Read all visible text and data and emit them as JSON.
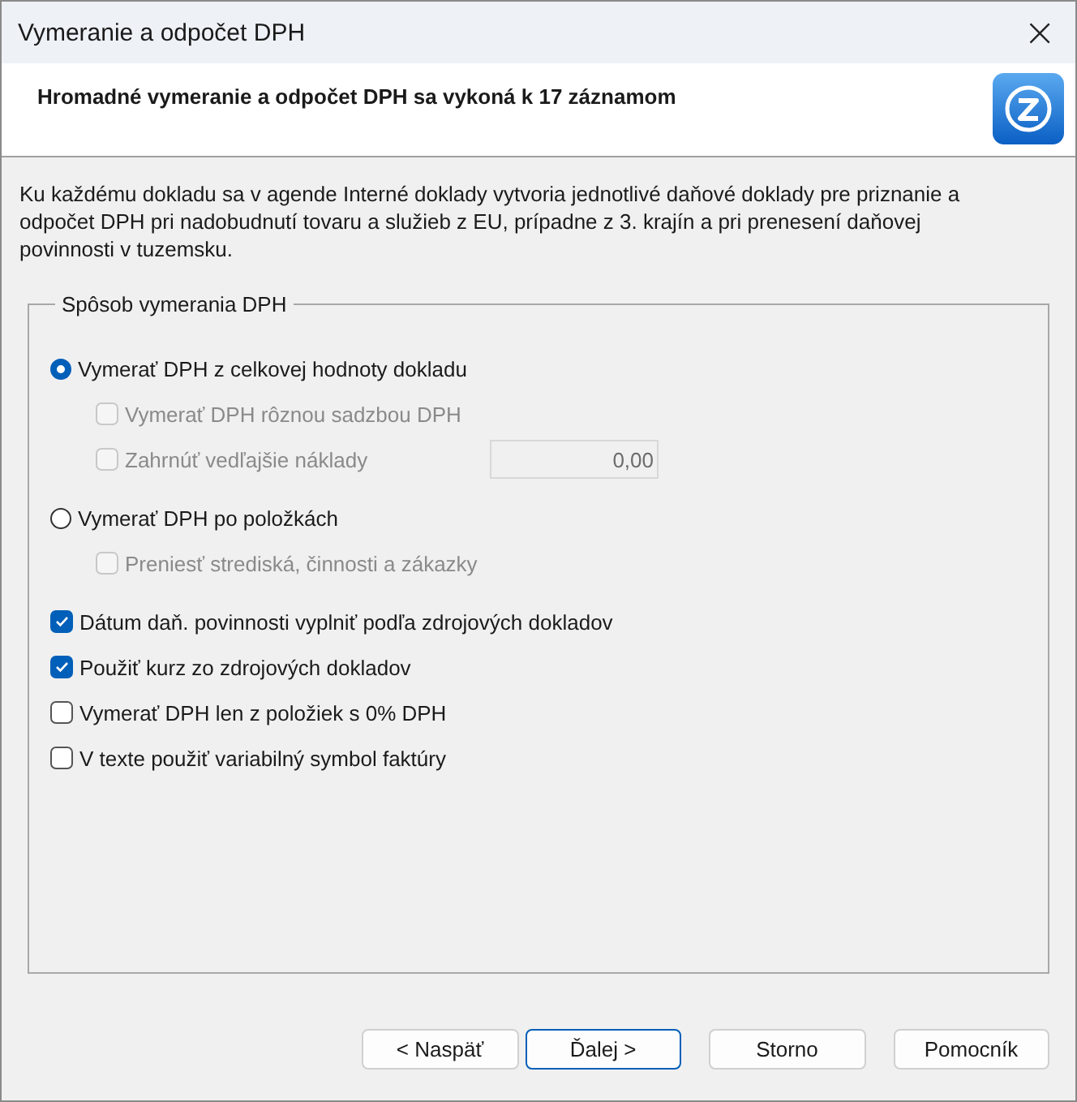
{
  "window": {
    "title": "Vymeranie a odpočet DPH",
    "close": "×"
  },
  "header": {
    "title": "Hromadné vymeranie a odpočet DPH sa vykoná k 17 záznamom"
  },
  "description": "Ku každému dokladu sa v agende Interné doklady vytvoria jednotlivé daňové doklady pre priznanie a odpočet DPH pri nadobudnutí tovaru a služieb z EU, prípadne z 3. krajín a pri prenesení daňovej povinnosti v tuzemsku.",
  "group": {
    "title": "Spôsob vymerania DPH",
    "methods": [
      {
        "label": "Vymerať DPH z celkovej hodnoty dokladu",
        "selected": true,
        "children": [
          {
            "label": "Vymerať DPH rôznou sadzbou DPH",
            "checked": false,
            "disabled": true
          },
          {
            "label": "Zahrnúť vedľajšie náklady",
            "checked": false,
            "disabled": true,
            "value": "0,00"
          }
        ]
      },
      {
        "label": "Vymerať DPH po položkách",
        "selected": false,
        "children": [
          {
            "label": "Preniesť strediská, činnosti a zákazky",
            "checked": false,
            "disabled": true
          }
        ]
      }
    ],
    "options": [
      {
        "label": "Dátum daň. povinnosti vyplniť podľa zdrojových dokladov",
        "checked": true
      },
      {
        "label": "Použiť kurz zo zdrojových dokladov",
        "checked": true
      },
      {
        "label": "Vymerať DPH len z položiek s 0% DPH",
        "checked": false
      },
      {
        "label": "V texte použiť variabilný symbol faktúry",
        "checked": false
      }
    ]
  },
  "buttons": [
    {
      "label": "< Naspäť",
      "default": false
    },
    {
      "label": "Ďalej >",
      "default": true
    },
    {
      "label": "Storno",
      "default": false
    },
    {
      "label": "Pomocník",
      "default": false
    }
  ]
}
